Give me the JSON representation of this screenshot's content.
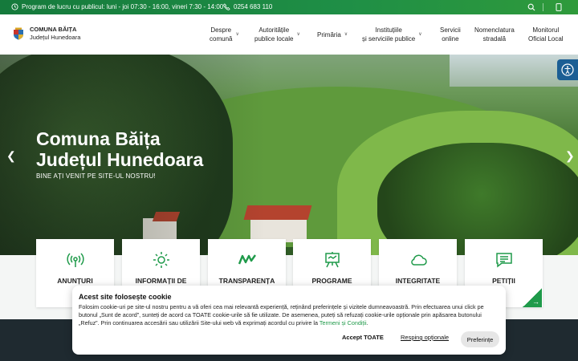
{
  "topbar": {
    "hours": "Program de lucru cu publicul: luni - joi 07:30 - 16:00, vineri 7:30 - 14:00",
    "phone": "0254 683 110"
  },
  "header": {
    "brand_line1": "COMUNA BĂIȚA",
    "brand_line2": "Județul Hunedoara",
    "nav": [
      {
        "line1": "Despre",
        "line2": "comună"
      },
      {
        "line1": "Autoritățile",
        "line2": "publice locale"
      },
      {
        "line1": "Primăria",
        "line2": ""
      },
      {
        "line1": "Instituțiile",
        "line2": "și serviciile publice"
      },
      {
        "line1": "Servicii",
        "line2": "online"
      },
      {
        "line1": "Nomenclatura",
        "line2": "stradală"
      },
      {
        "line1": "Monitorul",
        "line2": "Oficial Local"
      }
    ]
  },
  "hero": {
    "title_line1": "Comuna Băița",
    "title_line2": "Județul Hunedoara",
    "subtitle": "BINE AȚI VENIT PE SITE-UL NOSTRU!"
  },
  "cards": [
    {
      "label": "ANUNȚURI",
      "icon": "broadcast-icon"
    },
    {
      "label": "INFORMAȚII DE",
      "icon": "sun-icon"
    },
    {
      "label": "TRANSPARENȚA",
      "icon": "mv-icon"
    },
    {
      "label": "PROGRAME",
      "icon": "easel-icon"
    },
    {
      "label": "INTEGRITATE",
      "icon": "cloud-icon"
    },
    {
      "label": "PETIȚII",
      "icon": "message-icon"
    }
  ],
  "cookie": {
    "title": "Acest site folosește cookie",
    "body": "Folosim cookie-uri pe site-ul nostru pentru a vă oferi cea mai relevantă experiență, reținând preferințele și vizitele dumneavoastră. Prin efectuarea unui click pe butonul „Sunt de acord”, sunteți de acord ca TOATE cookie-urile să fie utilizate. De asemenea, puteți să refuzați cookie-urile opționale prin apăsarea butonului „Refuz”. Prin continuarea accesării sau utilizării Site-ului web vă exprimați acordul cu privire la",
    "link": "Termeni și Condiții",
    "accept": "Accept TOATE",
    "reject": "Resping opționale",
    "prefs": "Preferințe"
  },
  "colors": {
    "brand_green": "#1f9a4a",
    "accessibility_blue": "#1b5e94"
  }
}
